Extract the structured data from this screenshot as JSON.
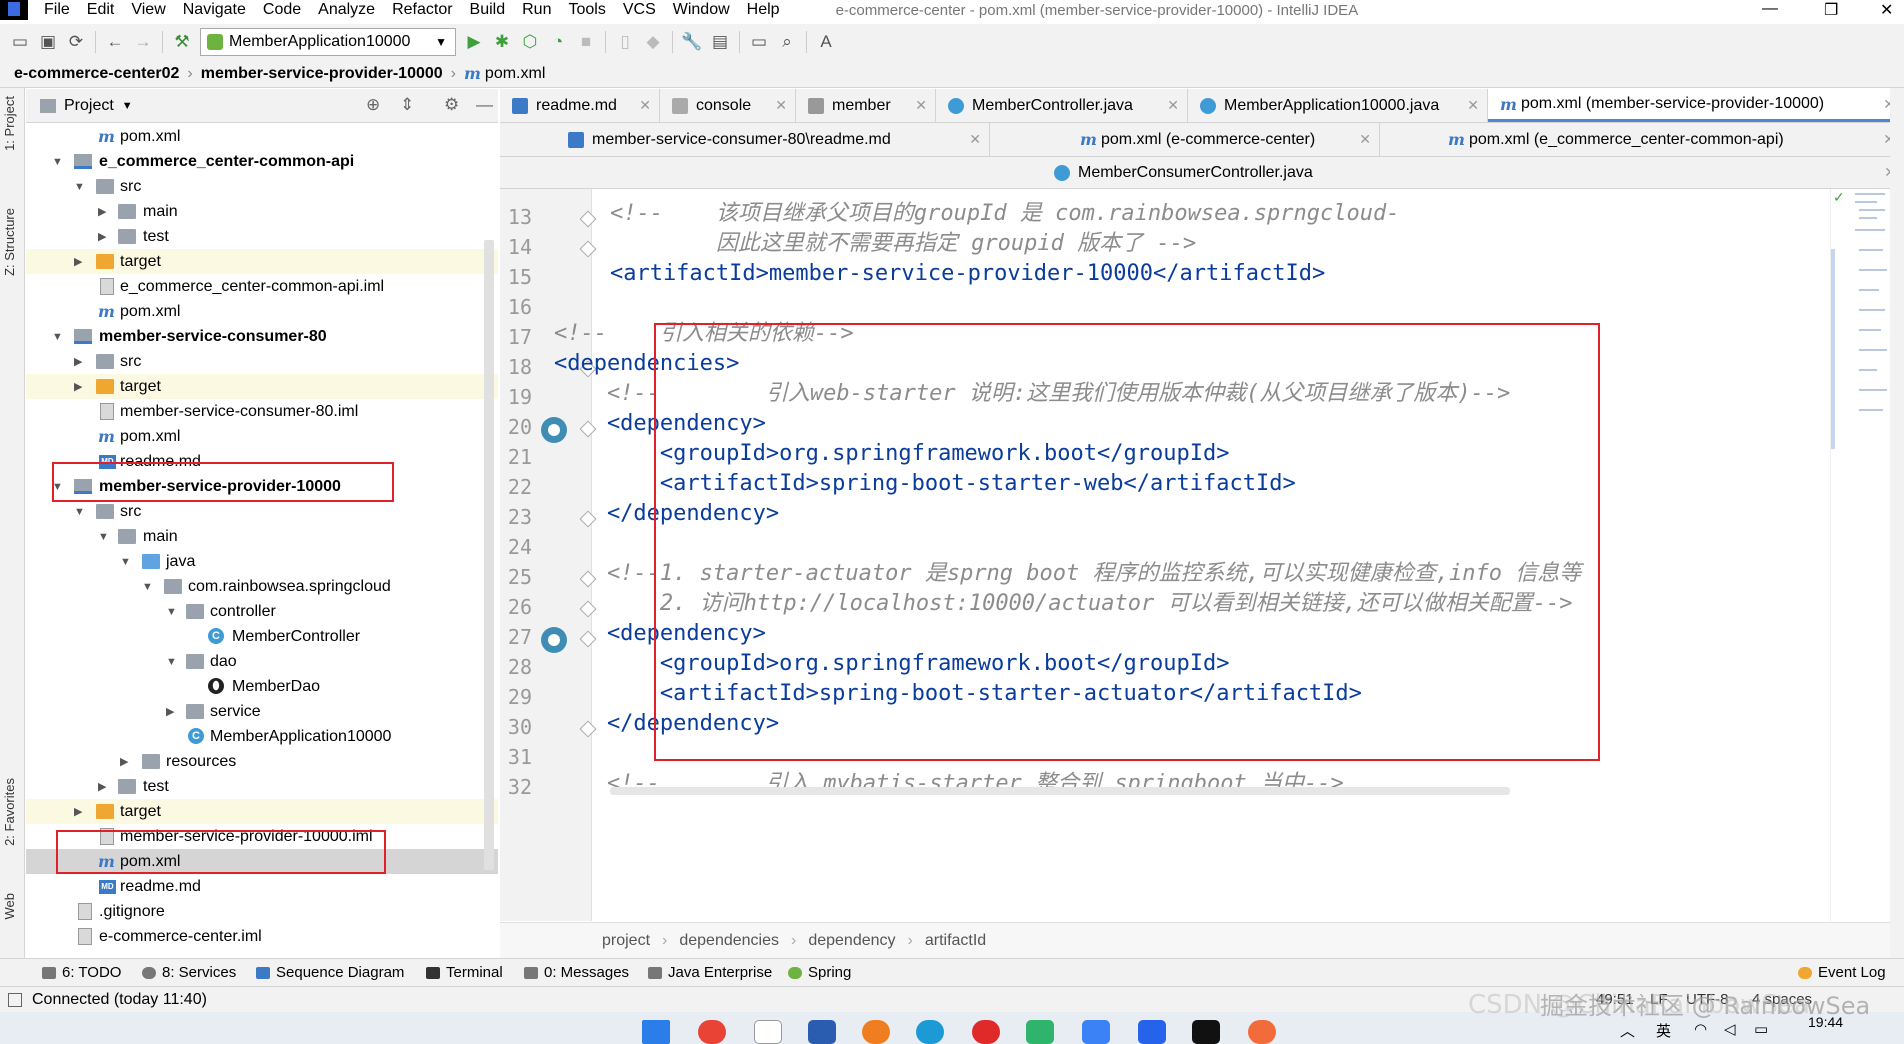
{
  "menubar": {
    "items": [
      "File",
      "Edit",
      "View",
      "Navigate",
      "Code",
      "Analyze",
      "Refactor",
      "Build",
      "Run",
      "Tools",
      "VCS",
      "Window",
      "Help"
    ],
    "window_title": "e-commerce-center - pom.xml (member-service-provider-10000) - IntelliJ IDEA"
  },
  "toolbar": {
    "run_config": "MemberApplication10000"
  },
  "navbar": {
    "crumbs": [
      "e-commerce-center02",
      "member-service-provider-10000",
      "pom.xml"
    ]
  },
  "left_stripe": {
    "project": "1: Project",
    "structure": "Z: Structure",
    "favorites": "2: Favorites",
    "web": "Web"
  },
  "project_panel": {
    "title": "Project",
    "tree": [
      {
        "label": "pom.xml",
        "icon": "m"
      },
      {
        "label": "e_commerce_center-common-api",
        "icon": "module"
      },
      {
        "label": "src",
        "icon": "folder"
      },
      {
        "label": "main",
        "icon": "folder"
      },
      {
        "label": "test",
        "icon": "folder"
      },
      {
        "label": "target",
        "icon": "folder-orange"
      },
      {
        "label": "e_commerce_center-common-api.iml",
        "icon": "file"
      },
      {
        "label": "pom.xml",
        "icon": "m"
      },
      {
        "label": "member-service-consumer-80",
        "icon": "module"
      },
      {
        "label": "src",
        "icon": "folder"
      },
      {
        "label": "target",
        "icon": "folder-orange"
      },
      {
        "label": "member-service-consumer-80.iml",
        "icon": "file"
      },
      {
        "label": "pom.xml",
        "icon": "m"
      },
      {
        "label": "readme.md",
        "icon": "md"
      },
      {
        "label": "member-service-provider-10000",
        "icon": "module"
      },
      {
        "label": "src",
        "icon": "folder"
      },
      {
        "label": "main",
        "icon": "folder"
      },
      {
        "label": "java",
        "icon": "folder-blue"
      },
      {
        "label": "com.rainbowsea.springcloud",
        "icon": "package"
      },
      {
        "label": "controller",
        "icon": "package"
      },
      {
        "label": "MemberController",
        "icon": "class"
      },
      {
        "label": "dao",
        "icon": "package"
      },
      {
        "label": "MemberDao",
        "icon": "interface"
      },
      {
        "label": "service",
        "icon": "package"
      },
      {
        "label": "MemberApplication10000",
        "icon": "class"
      },
      {
        "label": "resources",
        "icon": "folder"
      },
      {
        "label": "test",
        "icon": "folder"
      },
      {
        "label": "target",
        "icon": "folder-orange"
      },
      {
        "label": "member-service-provider-10000.iml",
        "icon": "file"
      },
      {
        "label": "pom.xml",
        "icon": "m"
      },
      {
        "label": "readme.md",
        "icon": "md"
      },
      {
        "label": ".gitignore",
        "icon": "file"
      },
      {
        "label": "e-commerce-center.iml",
        "icon": "file"
      }
    ]
  },
  "tabs": {
    "row1": [
      "readme.md",
      "console",
      "member",
      "MemberController.java",
      "MemberApplication10000.java",
      "pom.xml (member-service-provider-10000)"
    ],
    "row2": [
      "member-service-consumer-80\\readme.md",
      "pom.xml (e-commerce-center)",
      "pom.xml (e_commerce_center-common-api)"
    ],
    "row3": [
      "MemberConsumerController.java"
    ]
  },
  "editor": {
    "line_numbers": [
      "13",
      "14",
      "15",
      "16",
      "17",
      "18",
      "19",
      "20",
      "21",
      "22",
      "23",
      "24",
      "25",
      "26",
      "27",
      "28",
      "29",
      "30",
      "31",
      "32"
    ],
    "lines": [
      "        <!--    该项目继承父项目的groupId 是 com.rainbowsea.sprngcloud-",
      "                因此这里就不需要再指定 groupid 版本了 -->",
      "        <artifactId>member-service-provider-10000</artifactId>",
      "",
      "        <!--    引入相关的依赖-->",
      "        <dependencies>",
      "            <!--        引入web-starter 说明:这里我们使用版本仲裁(从父项目继承了版本)-->",
      "            <dependency>",
      "                <groupId>org.springframework.boot</groupId>",
      "                <artifactId>spring-boot-starter-web</artifactId>",
      "            </dependency>",
      "",
      "            <!--1. starter-actuator 是sprng boot 程序的监控系统,可以实现健康检查,info 信息等",
      "                2. 访问http://localhost:10000/actuator 可以看到相关链接,还可以做相关配置-->",
      "            <dependency>",
      "                <groupId>org.springframework.boot</groupId>",
      "                <artifactId>spring-boot-starter-actuator</artifactId>",
      "            </dependency>",
      "",
      "            <!--        引入 mybatis-starter 整合到 springboot 当中-->"
    ]
  },
  "editor_breadcrumb": [
    "project",
    "dependencies",
    "dependency",
    "artifactId"
  ],
  "tool_windows": [
    "6: TODO",
    "8: Services",
    "Sequence Diagram",
    "Terminal",
    "0: Messages",
    "Java Enterprise",
    "Spring"
  ],
  "event_log": "Event Log",
  "status": {
    "message": "Connected (today 11:40)",
    "position": "49:51",
    "line_sep": "LF",
    "encoding": "UTF-8",
    "indent": "4 spaces"
  },
  "taskbar": {
    "time": "19:44",
    "lang": "英"
  },
  "watermark": "CSDN @ChinaRainbowSea",
  "watermark2": "掘金技术社区 @ RainbowSea",
  "colors": {
    "accent": "#4a88d6",
    "selection_box": "#e0202a",
    "tag": "#0a3c9c",
    "comment": "#8c8c8c"
  }
}
